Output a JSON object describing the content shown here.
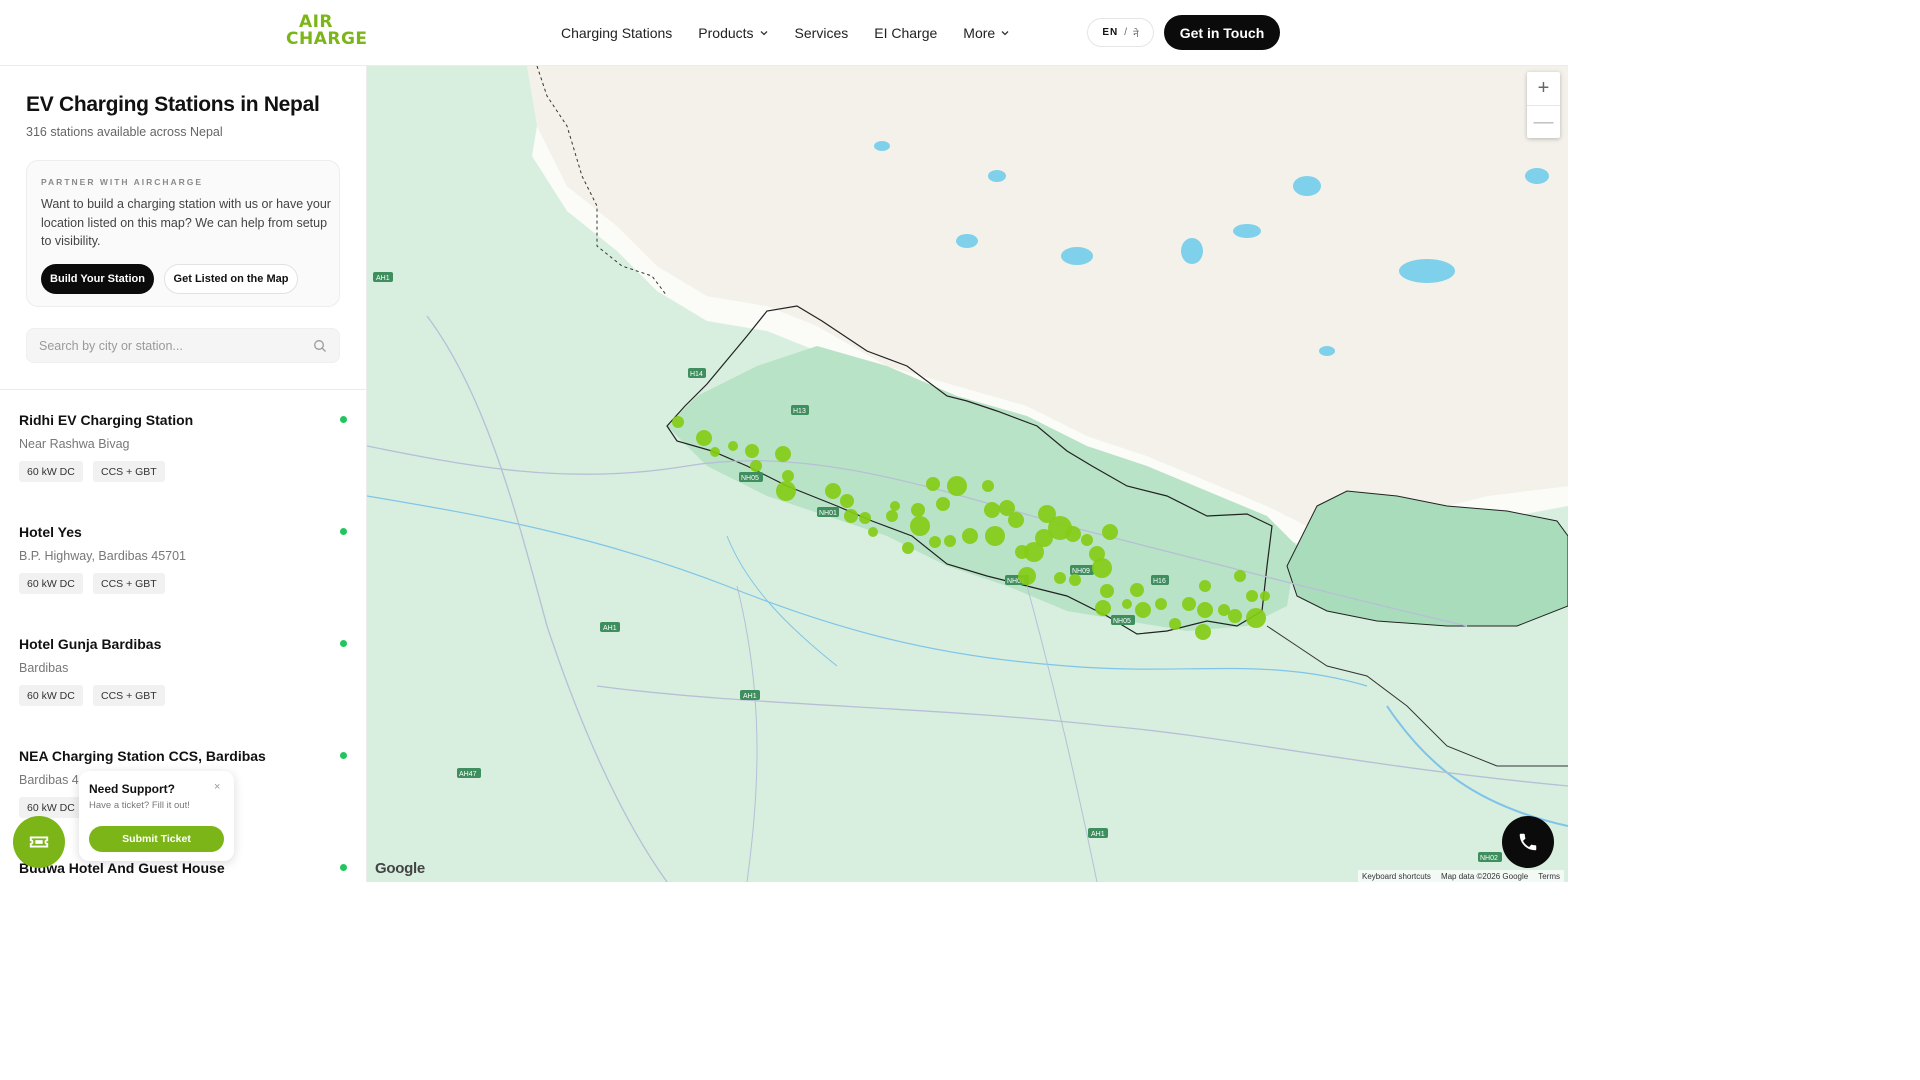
{
  "header": {
    "logo_top": "AIR",
    "logo_bottom": "CHARGE",
    "nav": {
      "charging_stations": "Charging Stations",
      "products": "Products",
      "services": "Services",
      "ei_charge": "EI Charge",
      "more": "More"
    },
    "lang_en": "EN",
    "lang_sep": "/",
    "lang_ne": "ने",
    "cta": "Get in Touch"
  },
  "sidebar": {
    "title": "EV Charging Stations in Nepal",
    "subtitle": "316 stations available across Nepal",
    "partner": {
      "eyebrow": "PARTNER WITH AIRCHARGE",
      "text": "Want to build a charging station with us or have your location listed on this map? We can help from setup to visibility.",
      "build_button": "Build Your Station",
      "listed_button": "Get Listed on the Map"
    },
    "search_placeholder": "Search by city or station...",
    "stations": [
      {
        "name": "Ridhi EV Charging Station",
        "address": "Near Rashwa Bivag",
        "power": "60 kW DC",
        "connectors": "CCS + GBT"
      },
      {
        "name": "Hotel Yes",
        "address": "B.P. Highway, Bardibas 45701",
        "power": "60 kW DC",
        "connectors": "CCS + GBT"
      },
      {
        "name": "Hotel Gunja Bardibas",
        "address": "Bardibas",
        "power": "60 kW DC",
        "connectors": "CCS + GBT"
      },
      {
        "name": "NEA Charging Station CCS, Bardibas",
        "address": "Bardibas 4",
        "power": "60 kW DC",
        "connectors": ""
      },
      {
        "name": "Budwa Hotel And Guest House",
        "address": "",
        "power": "",
        "connectors": ""
      }
    ],
    "status_color": "#22c55e"
  },
  "support": {
    "title": "Need Support?",
    "subtitle": "Have a ticket? Fill it out!",
    "close": "×",
    "button": "Submit Ticket"
  },
  "map": {
    "google_label": "Google",
    "keyboard_shortcuts": "Keyboard shortcuts",
    "map_data": "Map data ©2026 Google",
    "terms": "Terms",
    "zoom_in": "+",
    "zoom_out": "—",
    "marker_color": "#84cc16",
    "road_labels": [
      "AH1",
      "H14",
      "H13",
      "NH01",
      "NH05",
      "NH09",
      "NH05",
      "H16",
      "AH1",
      "AH1",
      "AH47",
      "AH1",
      "NH02",
      "NH01"
    ]
  },
  "colors": {
    "brand_green": "#7cb518",
    "dark": "#0b0b0b"
  }
}
